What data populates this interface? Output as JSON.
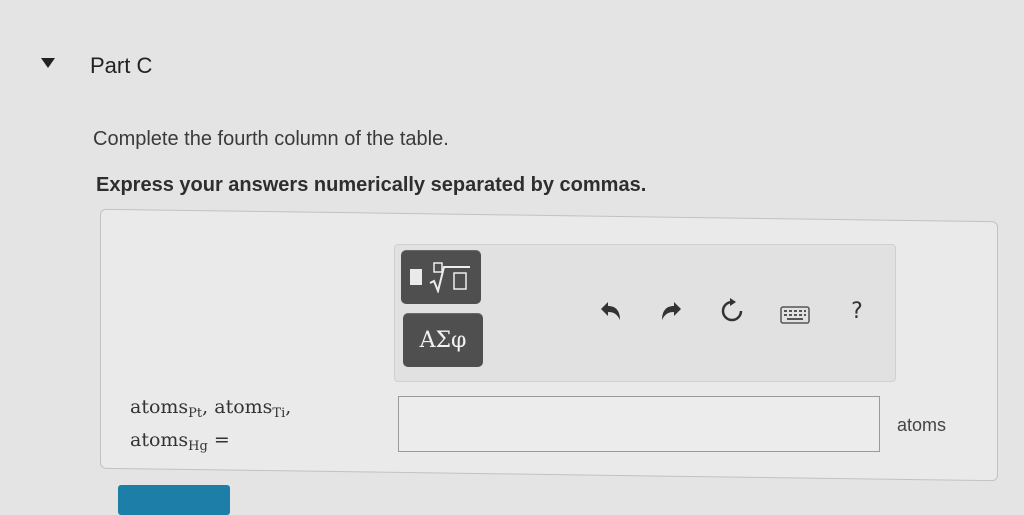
{
  "part": {
    "title": "Part C"
  },
  "question": {
    "instruction": "Complete the fourth column of the table.",
    "instruction_bold": "Express your answers numerically separated by commas."
  },
  "toolbar": {
    "templates_icon": "fraction-sqrt-templates-icon",
    "symbols_label": "ΑΣφ",
    "undo_icon": "undo-icon",
    "redo_icon": "redo-icon",
    "reset_icon": "reset-icon",
    "keyboard_icon": "keyboard-icon",
    "help_label": "?"
  },
  "answer": {
    "label_line1_a": "atoms",
    "label_sub_pt": "Pt",
    "label_sep1": ", atoms",
    "label_sub_ti": "Ti",
    "label_sep2": ",",
    "label_line2_a": "atoms",
    "label_sub_hg": "Hg",
    "label_eq": " =",
    "value": "",
    "unit": "atoms"
  },
  "colors": {
    "submit": "#1d7fa8",
    "tool_button": "#4f4f4f"
  }
}
